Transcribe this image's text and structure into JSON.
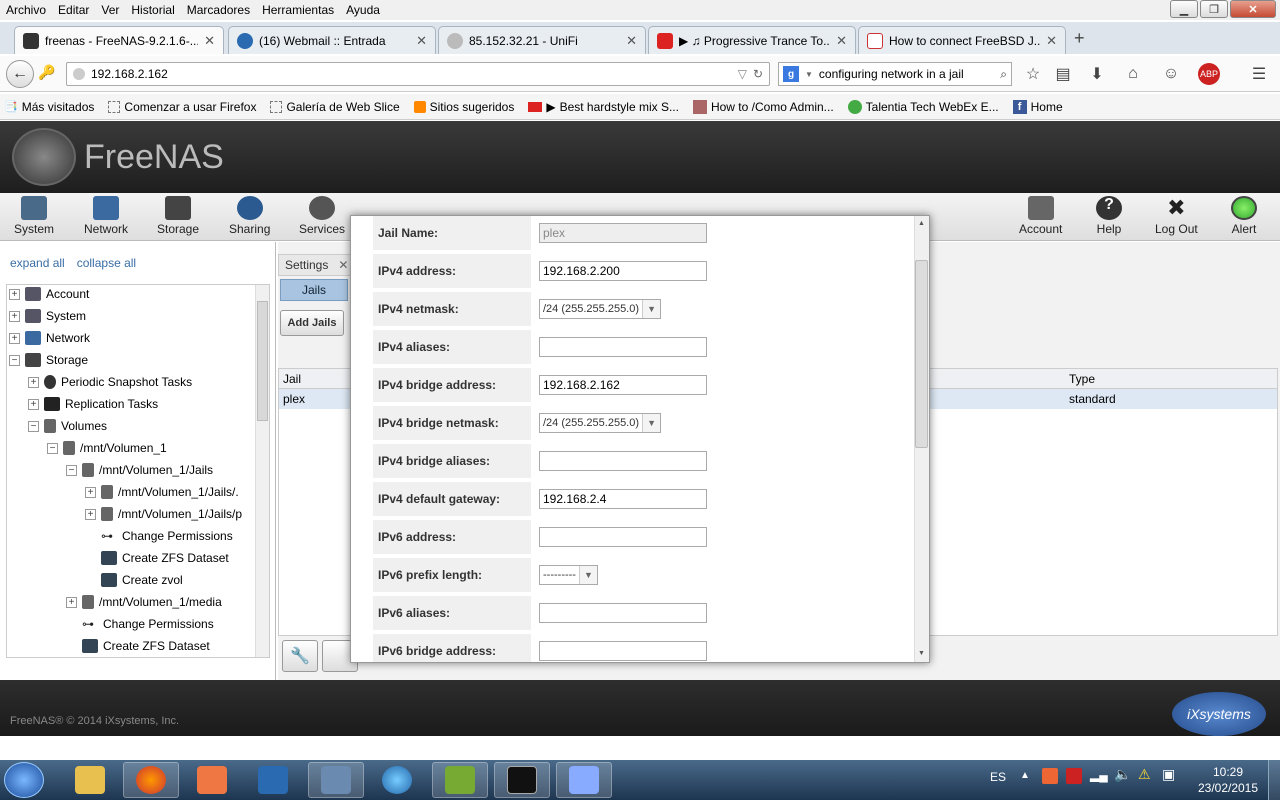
{
  "menu": [
    "Archivo",
    "Editar",
    "Ver",
    "Historial",
    "Marcadores",
    "Herramientas",
    "Ayuda"
  ],
  "tabs": [
    {
      "label": "freenas - FreeNAS-9.2.1.6-...",
      "color": "#333"
    },
    {
      "label": "(16) Webmail :: Entrada",
      "color": "#2a6ab0"
    },
    {
      "label": "85.152.32.21 - UniFi",
      "color": "#aaa"
    },
    {
      "label": "▶ ♫ Progressive Trance To...",
      "color": "#d22"
    },
    {
      "label": "How to connect FreeBSD J...",
      "color": "#c33"
    }
  ],
  "url": "192.168.2.162",
  "search": "configuring network in a jail",
  "bookmarks": [
    "Más visitados",
    "Comenzar a usar Firefox",
    "Galería de Web Slice",
    "Sitios sugeridos",
    "Best hardstyle mix S...",
    "How to /Como Admin...",
    "Talentia Tech WebEx E...",
    "Home"
  ],
  "freenas": {
    "logo": "FreeNAS",
    "toolbar_left": [
      "System",
      "Network",
      "Storage",
      "Sharing",
      "Services"
    ],
    "toolbar_right": [
      "Account",
      "Help",
      "Log Out",
      "Alert"
    ],
    "expand_all": "expand all",
    "collapse_all": "collapse all",
    "tree": [
      {
        "label": "Account",
        "pm": "+"
      },
      {
        "label": "System",
        "pm": "+"
      },
      {
        "label": "Network",
        "pm": "+"
      },
      {
        "label": "Storage",
        "pm": "−"
      },
      {
        "label": "Periodic Snapshot Tasks",
        "pm": "+"
      },
      {
        "label": "Replication Tasks",
        "pm": "+"
      },
      {
        "label": "Volumes",
        "pm": "−"
      },
      {
        "label": "/mnt/Volumen_1",
        "pm": "−"
      },
      {
        "label": "/mnt/Volumen_1/Jails",
        "pm": "−"
      },
      {
        "label": "/mnt/Volumen_1/Jails/.",
        "pm": "+"
      },
      {
        "label": "/mnt/Volumen_1/Jails/p",
        "pm": "+"
      },
      {
        "label": "Change Permissions",
        "pm": ""
      },
      {
        "label": "Create ZFS Dataset",
        "pm": ""
      },
      {
        "label": "Create zvol",
        "pm": ""
      },
      {
        "label": "/mnt/Volumen_1/media",
        "pm": "+"
      },
      {
        "label": "Change Permissions",
        "pm": ""
      },
      {
        "label": "Create ZFS Dataset",
        "pm": ""
      }
    ],
    "settings_tab": "Settings",
    "jails_tab": "Jails",
    "add_jails": "Add Jails",
    "table_headers": {
      "jail": "Jail",
      "type": "Type"
    },
    "table_row": {
      "jail": "plex",
      "type": "standard"
    },
    "copyright": "FreeNAS® © 2014 iXsystems, Inc.",
    "ix_logo": "iXsystems"
  },
  "form": [
    {
      "label": "Jail Name:",
      "kind": "input",
      "value": "plex",
      "disabled": true
    },
    {
      "label": "IPv4 address:",
      "kind": "input",
      "value": "192.168.2.200"
    },
    {
      "label": "IPv4 netmask:",
      "kind": "select",
      "value": "/24 (255.255.255.0)"
    },
    {
      "label": "IPv4 aliases:",
      "kind": "input",
      "value": ""
    },
    {
      "label": "IPv4 bridge address:",
      "kind": "input",
      "value": "192.168.2.162"
    },
    {
      "label": "IPv4 bridge netmask:",
      "kind": "select",
      "value": "/24 (255.255.255.0)"
    },
    {
      "label": "IPv4 bridge aliases:",
      "kind": "input",
      "value": ""
    },
    {
      "label": "IPv4 default gateway:",
      "kind": "input",
      "value": "192.168.2.4"
    },
    {
      "label": "IPv6 address:",
      "kind": "input",
      "value": ""
    },
    {
      "label": "IPv6 prefix length:",
      "kind": "select",
      "value": "---------"
    },
    {
      "label": "IPv6 aliases:",
      "kind": "input",
      "value": ""
    },
    {
      "label": "IPv6 bridge address:",
      "kind": "input",
      "value": ""
    }
  ],
  "taskbar": {
    "lang": "ES",
    "time": "10:29",
    "date": "23/02/2015"
  }
}
